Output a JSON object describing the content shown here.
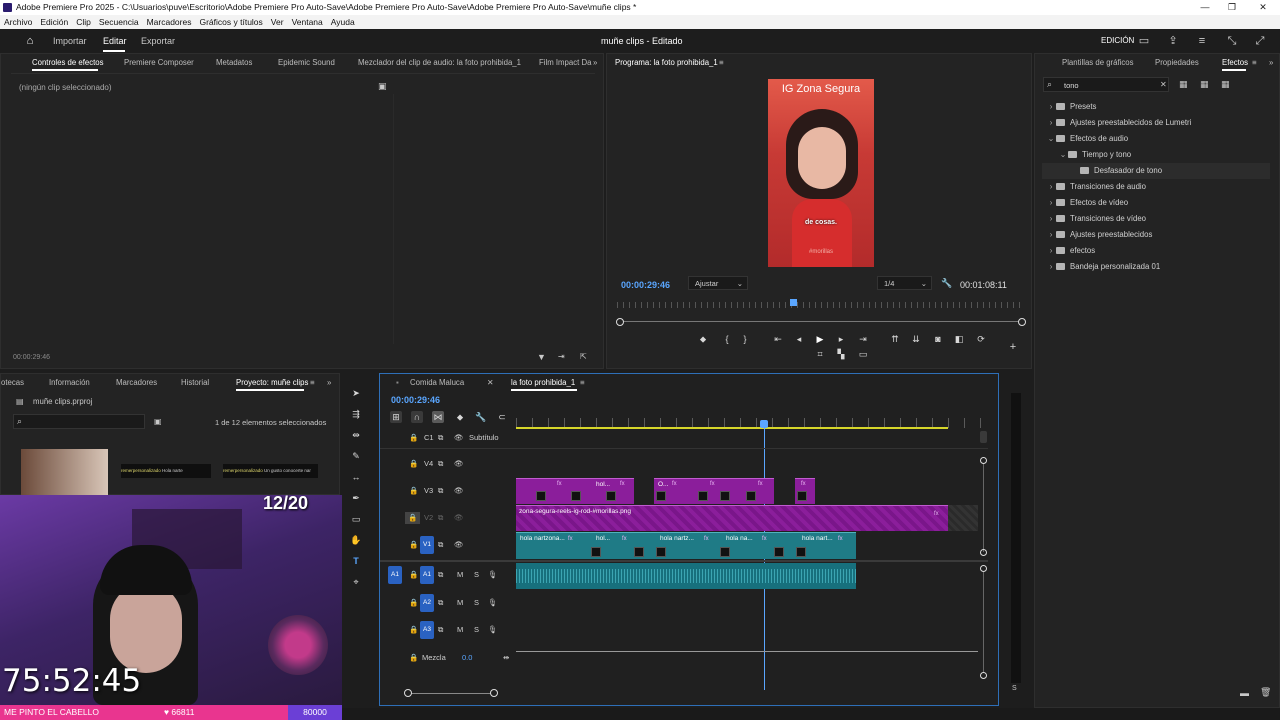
{
  "window": {
    "title": "Adobe Premiere Pro 2025 - C:\\Usuarios\\puve\\Escritorio\\Adobe Premiere Pro Auto-Save\\Adobe Premiere Pro Auto-Save\\Adobe Premiere Pro Auto-Save\\muñe clips *"
  },
  "menu": [
    "Archivo",
    "Edición",
    "Clip",
    "Secuencia",
    "Marcadores",
    "Gráficos y títulos",
    "Ver",
    "Ventana",
    "Ayuda"
  ],
  "topbar": {
    "import": "Importar",
    "edit": "Editar",
    "export": "Exportar",
    "project_title": "muñe clips - Editado",
    "workspace": "EDICIÓN"
  },
  "effect_controls": {
    "tabs": [
      "Controles de efectos",
      "Premiere Composer",
      "Metadatos",
      "Epidemic Sound",
      "Mezclador del clip de audio: la foto prohibida_1",
      "Film Impact Da"
    ],
    "empty": "(ningún clip seleccionado)",
    "timecode": "00:00:29:46"
  },
  "program": {
    "tab": "Programa: la foto prohibida_1",
    "video_title": "IG Zona Segura",
    "caption": "de cosas.",
    "watermark": "#morillas",
    "timecode": "00:00:29:46",
    "fit": "Ajustar",
    "quality": "1/4",
    "duration": "00:01:08:11"
  },
  "effects_panel": {
    "tabs": [
      "Plantillas de gráficos",
      "Propiedades",
      "Efectos"
    ],
    "search": "tono",
    "tree": [
      {
        "label": "Presets",
        "level": 0,
        "open": false
      },
      {
        "label": "Ajustes preestablecidos de Lumetri",
        "level": 0,
        "open": false
      },
      {
        "label": "Efectos de audio",
        "level": 0,
        "open": true
      },
      {
        "label": "Tiempo y tono",
        "level": 1,
        "open": true
      },
      {
        "label": "Desfasador de tono",
        "level": 2,
        "open": false
      },
      {
        "label": "Transiciones de audio",
        "level": 0,
        "open": false
      },
      {
        "label": "Efectos de vídeo",
        "level": 0,
        "open": false
      },
      {
        "label": "Transiciones de vídeo",
        "level": 0,
        "open": false
      },
      {
        "label": "Ajustes preestablecidos",
        "level": 0,
        "open": false
      },
      {
        "label": "efectos",
        "level": 0,
        "open": false
      },
      {
        "label": "Bandeja personalizada 01",
        "level": 0,
        "open": false
      }
    ]
  },
  "project": {
    "tabs": [
      "otecas",
      "Información",
      "Marcadores",
      "Historial",
      "Proyecto: muñe clips"
    ],
    "file": "muñe clips.prproj",
    "count": "1 de 12 elementos seleccionados",
    "thumb_labels": [
      "remerpersonalizado",
      "Hola narte",
      "remerpersonalizado",
      "Un gusto conocerte nar"
    ]
  },
  "timeline": {
    "tabs": [
      "Comida Maluca",
      "la foto prohibida_1"
    ],
    "timecode": "00:00:29:46",
    "tracks": {
      "c1": "C1",
      "subtitle": "Subtítulo",
      "v4": "V4",
      "v3": "V3",
      "v2": "V2",
      "v1": "V1",
      "a1": "A1",
      "a2": "A2",
      "a3": "A3",
      "mix": "Mezcla",
      "mix_val": "0.0",
      "m": "M",
      "s": "S"
    },
    "v3_clip_labels": [
      "hol...",
      "O..."
    ],
    "v2_clip": "zona-segura-reels-ig-rod-#morillas.png",
    "v1_clip_labels": [
      "hola nartzona...",
      "hol...",
      "hola nartz...",
      "hola na...",
      "hola nart..."
    ],
    "fx": "fx"
  },
  "stream_overlay": {
    "counter": "12/20",
    "timer": "75:52:45",
    "banner": "ME PINTO EL CABELLO",
    "viewers": "66811",
    "goal": "80000"
  },
  "colors": {
    "accent_blue": "#5aa6ff",
    "clip_teal": "#1f7b86",
    "clip_purple": "#8b1e9b",
    "banner_pink": "#e9358f",
    "goal_purple": "#6b3fd6",
    "ruler_yellow": "#d6d62a"
  }
}
